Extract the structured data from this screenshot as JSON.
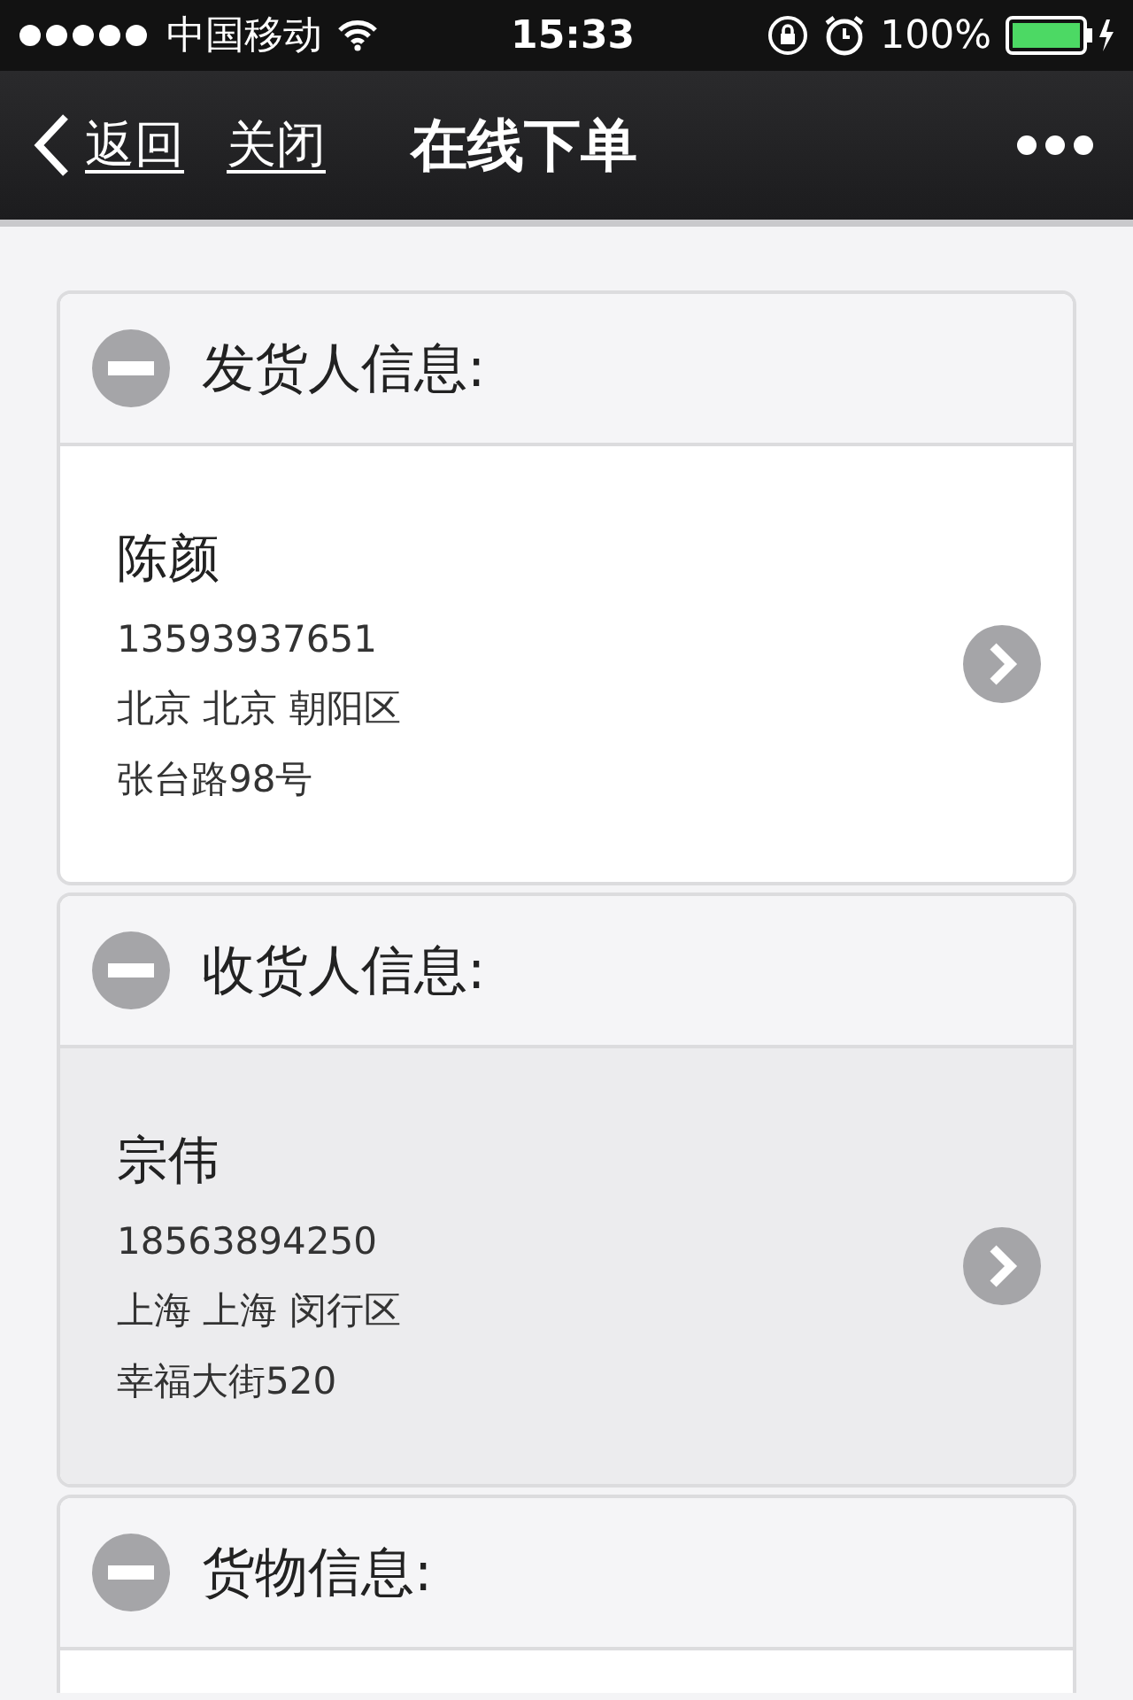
{
  "status_bar": {
    "carrier": "中国移动",
    "time": "15:33",
    "battery": "100%"
  },
  "nav": {
    "back": "返回",
    "close": "关闭",
    "title": "在线下单"
  },
  "sections": [
    {
      "title": "发货人信息:",
      "selected": false,
      "contact": {
        "name": "陈颜",
        "phone": "13593937651",
        "region": "北京 北京 朝阳区",
        "address": "张台路98号"
      }
    },
    {
      "title": "收货人信息:",
      "selected": true,
      "contact": {
        "name": "宗伟",
        "phone": "18563894250",
        "region": "上海 上海 闵行区",
        "address": "幸福大街520"
      }
    },
    {
      "title": "货物信息:"
    }
  ]
}
